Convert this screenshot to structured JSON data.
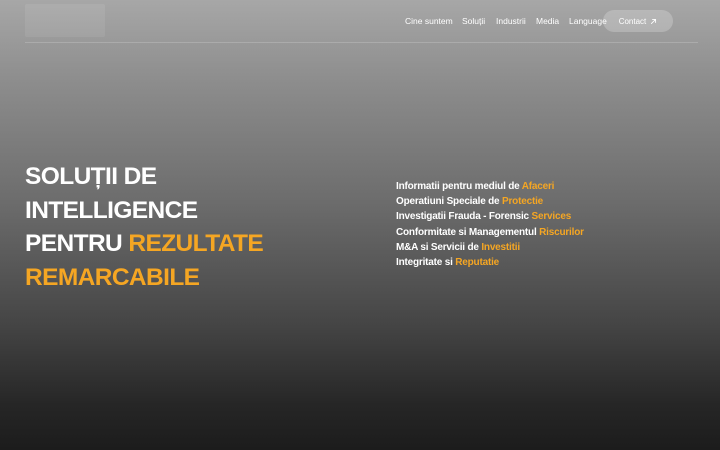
{
  "nav": {
    "items": [
      {
        "label": "Cine suntem"
      },
      {
        "label": "Soluții"
      },
      {
        "label": "Industrii"
      },
      {
        "label": "Media"
      },
      {
        "label": "Language"
      }
    ],
    "contact_label": "Contact"
  },
  "hero": {
    "line1": "SOLUȚII DE",
    "line2": "INTELLIGENCE",
    "line3_prefix": "PENTRU",
    "line3_accent": "REZULTATE",
    "line4_accent": "REMARCABILE"
  },
  "services": [
    {
      "prefix": "Informatii pentru mediul de",
      "accent": "Afaceri"
    },
    {
      "prefix": "Operatiuni Speciale de",
      "accent": "Protectie"
    },
    {
      "prefix": "Investigatii Frauda - Forensic",
      "accent": "Services"
    },
    {
      "prefix": "Conformitate si Managementul",
      "accent": "Riscurilor"
    },
    {
      "prefix": "M&A si Servicii de",
      "accent": "Investitii"
    },
    {
      "prefix": "Integritate si",
      "accent": "Reputatie"
    }
  ],
  "colors": {
    "accent": "#f5a623",
    "text": "#ffffff",
    "gradient_top": "#a7a7a7",
    "gradient_bottom": "#1c1c1c"
  },
  "icons": {
    "contact": "arrow-up-right-icon"
  }
}
